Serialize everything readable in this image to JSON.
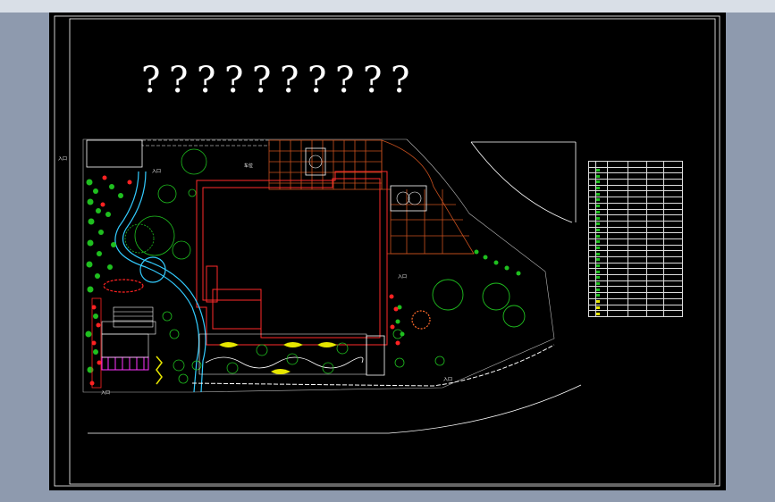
{
  "drawing": {
    "title_glyphs": [
      "?",
      "?",
      "?",
      "?",
      "?",
      "?",
      "?",
      "?",
      "?",
      "?"
    ],
    "labels": [
      {
        "id": "lbl-top-left-gate",
        "text": "入口"
      },
      {
        "id": "lbl-top-entrance",
        "text": "入口"
      },
      {
        "id": "lbl-parking",
        "text": "车位"
      },
      {
        "id": "lbl-east-gate",
        "text": "入口"
      },
      {
        "id": "lbl-bottom-gate",
        "text": "入口"
      },
      {
        "id": "lbl-bottom-right-gate",
        "text": "入口"
      }
    ],
    "colors": {
      "building": "#ff2a2a",
      "paving": "#cc4a20",
      "water": "#33ccff",
      "shrub": "#1fbf1f",
      "flower": "#ff2222",
      "pergola": "#ff33ff",
      "hedge": "#e6e600",
      "road": "#ffffff"
    }
  },
  "legend": {
    "rows": 26,
    "columns": 6
  }
}
